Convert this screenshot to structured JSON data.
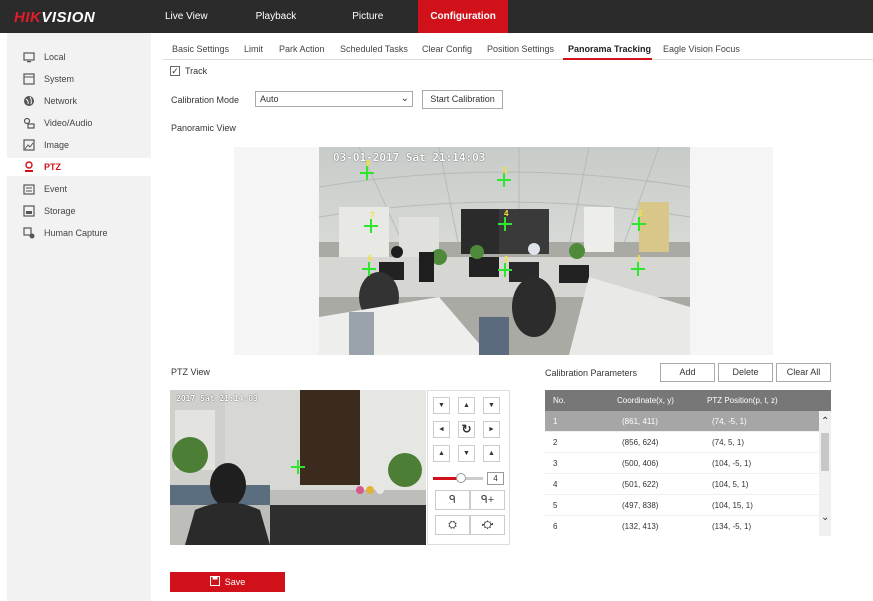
{
  "brand": {
    "logo_red": "HIK",
    "logo_white": "VISION"
  },
  "topnav": {
    "live_view": "Live View",
    "playback": "Playback",
    "picture": "Picture",
    "configuration": "Configuration"
  },
  "sidebar": {
    "items": [
      {
        "label": "Local",
        "icon": "monitor-icon"
      },
      {
        "label": "System",
        "icon": "system-icon"
      },
      {
        "label": "Network",
        "icon": "globe-icon"
      },
      {
        "label": "Video/Audio",
        "icon": "video-audio-icon"
      },
      {
        "label": "Image",
        "icon": "image-icon"
      },
      {
        "label": "PTZ",
        "icon": "ptz-icon"
      },
      {
        "label": "Event",
        "icon": "event-icon"
      },
      {
        "label": "Storage",
        "icon": "storage-icon"
      },
      {
        "label": "Human Capture",
        "icon": "human-capture-icon"
      }
    ]
  },
  "subtabs": [
    "Basic Settings",
    "Limit",
    "Park Action",
    "Scheduled Tasks",
    "Clear Config",
    "Position Settings",
    "Panorama Tracking",
    "Eagle Vision Focus"
  ],
  "track": {
    "label": "Track",
    "checked_glyph": "✓"
  },
  "calibration": {
    "mode_label": "Calibration Mode",
    "mode_value": "Auto",
    "start_button": "Start Calibration"
  },
  "panoramic": {
    "label": "Panoramic View",
    "osd": "03-01-2017 Sat 21:14:03",
    "points": [
      "1",
      "2",
      "3",
      "4",
      "5",
      "6",
      "7",
      "8"
    ]
  },
  "ptz_view": {
    "label": "PTZ View",
    "osd": "2017 Sat 21:14:03"
  },
  "ptz_controls": {
    "arrow_up_left": "▼",
    "arrow_up": "▲",
    "arrow_up_right": "▼",
    "arrow_left": "◄",
    "auto": "↻",
    "arrow_right": "►",
    "arrow_down_left": "▲",
    "arrow_down": "▼",
    "arrow_down_right": "▲",
    "speed": "4",
    "speed_level": 0.55,
    "zoom_out": "ᑫ",
    "zoom_in": "ᑫ+",
    "focus_near": "⛭",
    "focus_far": "⛮"
  },
  "calibration_params": {
    "label": "Calibration Parameters",
    "add": "Add",
    "delete": "Delete",
    "clear_all": "Clear All",
    "columns": [
      "No.",
      "Coordinate(x, y)",
      "PTZ Position(p, t, z)"
    ],
    "rows": [
      [
        "1",
        "(861, 411)",
        "(74, -5, 1)"
      ],
      [
        "2",
        "(856, 624)",
        "(74, 5, 1)"
      ],
      [
        "3",
        "(500, 406)",
        "(104, -5, 1)"
      ],
      [
        "4",
        "(501, 622)",
        "(104, 5, 1)"
      ],
      [
        "5",
        "(497, 838)",
        "(104, 15, 1)"
      ],
      [
        "6",
        "(132, 413)",
        "(134, -5, 1)"
      ]
    ]
  },
  "save": {
    "label": "Save"
  },
  "colors": {
    "accent": "#d0111a",
    "topbar": "#2b2b2b",
    "crosshair": "#2ee62e"
  }
}
